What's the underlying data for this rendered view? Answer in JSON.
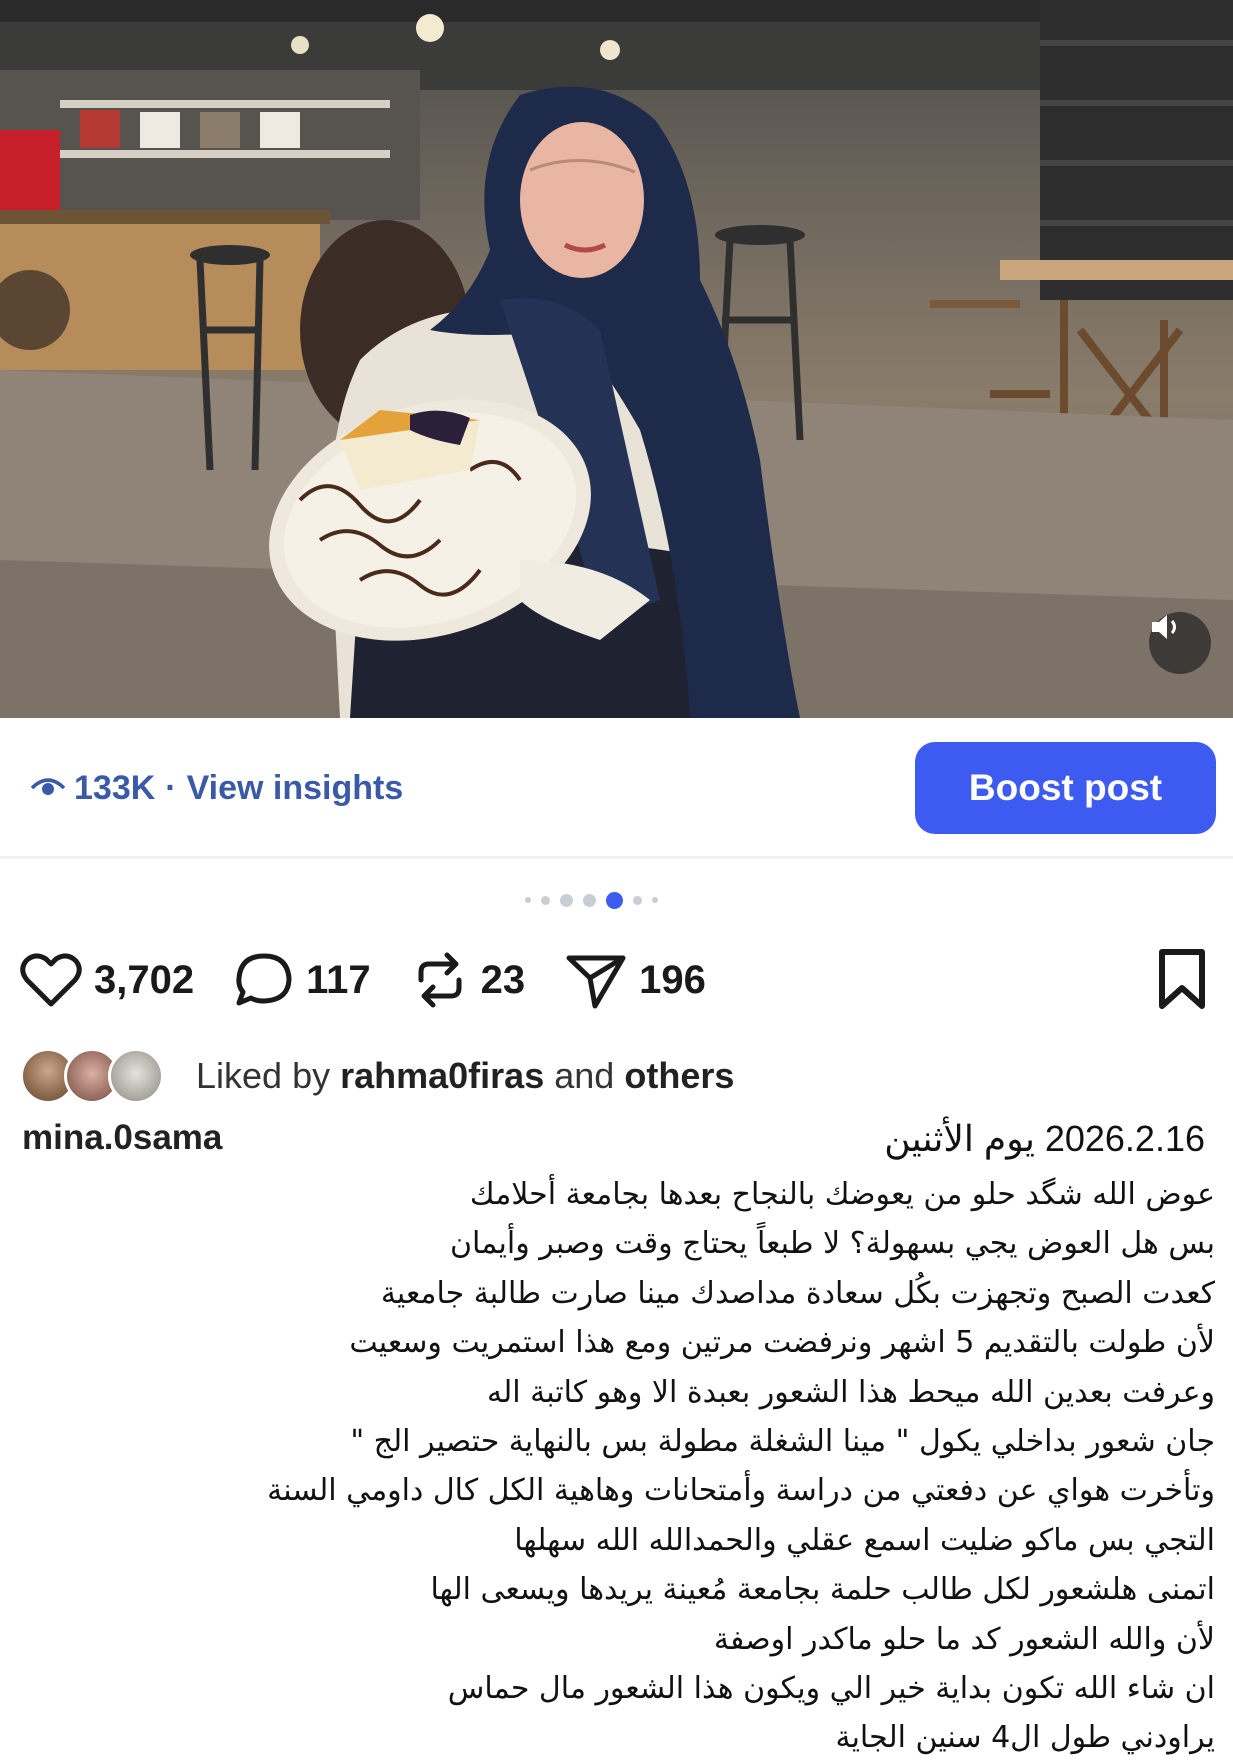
{
  "post": {
    "views": "133K",
    "separator": "·",
    "view_insights_label": "View insights",
    "boost_label": "Boost post",
    "carousel": {
      "count": 7,
      "active_index": 4
    },
    "stats": {
      "likes": "3,702",
      "comments": "117",
      "reposts": "23",
      "shares": "196"
    },
    "liked_by": {
      "prefix": "Liked by",
      "user": "rahma0firas",
      "middle": "and",
      "suffix": "others"
    },
    "username": "mina.0sama",
    "date": "2026.2.16 يوم الأثنين",
    "caption_lines": [
      "عوض الله شگد حلو من يعوضك بالنجاح بعدها بجامعة أحلامك",
      "بس هل العوض يجي بسهولة؟ لا طبعاً يحتاج وقت وصبر وأيمان",
      "كعدت الصبح وتجهزت بكُل سعادة مداصدك مينا صارت طالبة جامعية",
      "لأن طولت بالتقديم 5 اشهر ونرفضت مرتين ومع هذا استمريت وسعيت",
      "وعرفت بعدين الله ميحط هذا الشعور بعبدة الا وهو كاتبة اله",
      "جان شعور بداخلي يكول \" مينا الشغلة مطولة بس بالنهاية حتصير الج \"",
      "وتأخرت هواي عن دفعتي من دراسة وأمتحانات وهاهية الكل كال داومي السنة",
      "التجي بس ماكو ضليت اسمع عقلي والحمدالله الله سهلها",
      "اتمنى هلشعور لكل طالب حلمة بجامعة مُعينة يريدها ويسعى الها",
      "لأن والله الشعور كد ما حلو ماكدر اوصفة",
      "ان شاء الله تكون بداية خير الي ويكون هذا الشعور مال حماس",
      "يراودني طول ال4 سنين الجاية"
    ]
  },
  "icons": {
    "views": "eye-icon",
    "like": "heart-icon",
    "comment": "comment-bubble-icon",
    "repost": "repost-arrows-icon",
    "share": "send-paper-plane-icon",
    "save": "bookmark-icon",
    "sound": "speaker-icon"
  },
  "colors": {
    "accent": "#3d5af1",
    "insights_text": "#3a5aa8",
    "text": "#111111"
  }
}
